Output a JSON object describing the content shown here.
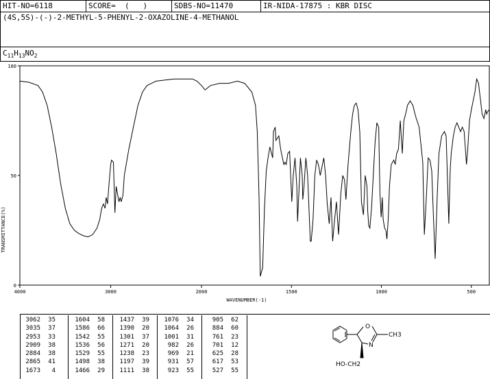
{
  "header": {
    "hit_no": "HIT-NO=6118",
    "score": "SCORE=  (   )",
    "sdbs_no": "SDBS-NO=11470",
    "ir_nida": "IR-NIDA-17875 : KBR DISC",
    "compound_name": "(4S,5S)-(-)-2-METHYL-5-PHENYL-2-OXAZOLINE-4-METHANOL",
    "formula_parts": [
      {
        "t": "C",
        "sub": false
      },
      {
        "t": "11",
        "sub": true
      },
      {
        "t": "H",
        "sub": false
      },
      {
        "t": "13",
        "sub": true
      },
      {
        "t": "NO",
        "sub": false
      },
      {
        "t": "2",
        "sub": true
      }
    ]
  },
  "chart_data": {
    "type": "line",
    "xlabel": "WAVENUMBER(-1)",
    "ylabel": "TRANSMITTANCE(%)",
    "xlim": [
      4000,
      400
    ],
    "ylim": [
      0,
      100
    ],
    "x_ticks": [
      4000,
      3000,
      2000,
      1500,
      1000,
      500
    ],
    "y_ticks": [
      0,
      50,
      100
    ],
    "series": [
      {
        "points": [
          [
            4000,
            93
          ],
          [
            3900,
            92.5
          ],
          [
            3800,
            91
          ],
          [
            3750,
            88
          ],
          [
            3700,
            82
          ],
          [
            3650,
            72
          ],
          [
            3600,
            60
          ],
          [
            3550,
            46
          ],
          [
            3500,
            35
          ],
          [
            3450,
            28
          ],
          [
            3400,
            25
          ],
          [
            3350,
            23.5
          ],
          [
            3300,
            22.5
          ],
          [
            3250,
            22
          ],
          [
            3200,
            23
          ],
          [
            3150,
            26
          ],
          [
            3120,
            30
          ],
          [
            3100,
            35
          ],
          [
            3080,
            37
          ],
          [
            3062,
            35
          ],
          [
            3050,
            40
          ],
          [
            3035,
            37
          ],
          [
            3020,
            45
          ],
          [
            3000,
            55
          ],
          [
            2990,
            57
          ],
          [
            2970,
            56
          ],
          [
            2953,
            33
          ],
          [
            2940,
            45
          ],
          [
            2909,
            38
          ],
          [
            2895,
            40
          ],
          [
            2884,
            38
          ],
          [
            2865,
            41
          ],
          [
            2850,
            50
          ],
          [
            2800,
            62
          ],
          [
            2750,
            72
          ],
          [
            2700,
            82
          ],
          [
            2650,
            88
          ],
          [
            2600,
            91
          ],
          [
            2550,
            92
          ],
          [
            2500,
            93
          ],
          [
            2400,
            93.5
          ],
          [
            2300,
            94
          ],
          [
            2200,
            94
          ],
          [
            2100,
            94
          ],
          [
            2050,
            93
          ],
          [
            2000,
            91
          ],
          [
            1980,
            89
          ],
          [
            1950,
            91
          ],
          [
            1900,
            92
          ],
          [
            1850,
            92
          ],
          [
            1800,
            93
          ],
          [
            1760,
            92
          ],
          [
            1740,
            90
          ],
          [
            1720,
            88
          ],
          [
            1700,
            82
          ],
          [
            1690,
            70
          ],
          [
            1680,
            40
          ],
          [
            1673,
            4
          ],
          [
            1660,
            8
          ],
          [
            1650,
            35
          ],
          [
            1640,
            52
          ],
          [
            1630,
            58
          ],
          [
            1620,
            63
          ],
          [
            1604,
            58
          ],
          [
            1600,
            70
          ],
          [
            1590,
            72
          ],
          [
            1586,
            66
          ],
          [
            1570,
            68
          ],
          [
            1560,
            62
          ],
          [
            1550,
            58
          ],
          [
            1542,
            55
          ],
          [
            1536,
            56
          ],
          [
            1529,
            55
          ],
          [
            1520,
            60
          ],
          [
            1510,
            61
          ],
          [
            1498,
            38
          ],
          [
            1490,
            50
          ],
          [
            1480,
            58
          ],
          [
            1470,
            45
          ],
          [
            1466,
            29
          ],
          [
            1460,
            40
          ],
          [
            1450,
            58
          ],
          [
            1440,
            50
          ],
          [
            1437,
            39
          ],
          [
            1430,
            45
          ],
          [
            1420,
            58
          ],
          [
            1410,
            50
          ],
          [
            1400,
            30
          ],
          [
            1395,
            20
          ],
          [
            1390,
            20
          ],
          [
            1380,
            30
          ],
          [
            1370,
            50
          ],
          [
            1360,
            57
          ],
          [
            1350,
            55
          ],
          [
            1340,
            50
          ],
          [
            1320,
            58
          ],
          [
            1310,
            50
          ],
          [
            1301,
            37
          ],
          [
            1290,
            28
          ],
          [
            1280,
            40
          ],
          [
            1271,
            20
          ],
          [
            1260,
            30
          ],
          [
            1250,
            38
          ],
          [
            1238,
            23
          ],
          [
            1225,
            42
          ],
          [
            1215,
            50
          ],
          [
            1205,
            48
          ],
          [
            1197,
            39
          ],
          [
            1185,
            55
          ],
          [
            1170,
            70
          ],
          [
            1160,
            78
          ],
          [
            1150,
            82
          ],
          [
            1140,
            83
          ],
          [
            1130,
            80
          ],
          [
            1120,
            70
          ],
          [
            1111,
            38
          ],
          [
            1100,
            32
          ],
          [
            1090,
            50
          ],
          [
            1080,
            45
          ],
          [
            1076,
            34
          ],
          [
            1070,
            27
          ],
          [
            1064,
            26
          ],
          [
            1055,
            35
          ],
          [
            1045,
            50
          ],
          [
            1035,
            65
          ],
          [
            1025,
            74
          ],
          [
            1015,
            72
          ],
          [
            1008,
            42
          ],
          [
            1001,
            31
          ],
          [
            995,
            40
          ],
          [
            990,
            30
          ],
          [
            982,
            26
          ],
          [
            975,
            25
          ],
          [
            969,
            21
          ],
          [
            962,
            30
          ],
          [
            955,
            45
          ],
          [
            945,
            55
          ],
          [
            931,
            57
          ],
          [
            923,
            55
          ],
          [
            915,
            60
          ],
          [
            905,
            62
          ],
          [
            895,
            75
          ],
          [
            884,
            60
          ],
          [
            875,
            75
          ],
          [
            865,
            78
          ],
          [
            855,
            82
          ],
          [
            840,
            84
          ],
          [
            825,
            82
          ],
          [
            810,
            77
          ],
          [
            790,
            72
          ],
          [
            770,
            56
          ],
          [
            761,
            23
          ],
          [
            750,
            40
          ],
          [
            740,
            58
          ],
          [
            730,
            57
          ],
          [
            720,
            52
          ],
          [
            710,
            30
          ],
          [
            701,
            12
          ],
          [
            690,
            40
          ],
          [
            680,
            60
          ],
          [
            665,
            68
          ],
          [
            650,
            70
          ],
          [
            640,
            68
          ],
          [
            635,
            55
          ],
          [
            625,
            28
          ],
          [
            617,
            53
          ],
          [
            612,
            60
          ],
          [
            600,
            68
          ],
          [
            590,
            72
          ],
          [
            580,
            74
          ],
          [
            570,
            72
          ],
          [
            560,
            70
          ],
          [
            550,
            72
          ],
          [
            540,
            70
          ],
          [
            527,
            55
          ],
          [
            520,
            62
          ],
          [
            510,
            75
          ],
          [
            500,
            80
          ],
          [
            490,
            84
          ],
          [
            480,
            88
          ],
          [
            470,
            94
          ],
          [
            460,
            92
          ],
          [
            450,
            85
          ],
          [
            440,
            78
          ],
          [
            430,
            76
          ],
          [
            420,
            80
          ],
          [
            415,
            78
          ],
          [
            410,
            79
          ],
          [
            400,
            80
          ]
        ]
      }
    ]
  },
  "peaks": [
    [
      [
        "3062",
        "35"
      ],
      [
        "3035",
        "37"
      ],
      [
        "2953",
        "33"
      ],
      [
        "2909",
        "38"
      ],
      [
        "2884",
        "38"
      ],
      [
        "2865",
        "41"
      ],
      [
        "1673",
        "4"
      ]
    ],
    [
      [
        "1604",
        "58"
      ],
      [
        "1586",
        "66"
      ],
      [
        "1542",
        "55"
      ],
      [
        "1536",
        "56"
      ],
      [
        "1529",
        "55"
      ],
      [
        "1498",
        "38"
      ],
      [
        "1466",
        "29"
      ]
    ],
    [
      [
        "1437",
        "39"
      ],
      [
        "1390",
        "20"
      ],
      [
        "1301",
        "37"
      ],
      [
        "1271",
        "20"
      ],
      [
        "1238",
        "23"
      ],
      [
        "1197",
        "39"
      ],
      [
        "1111",
        "38"
      ]
    ],
    [
      [
        "1076",
        "34"
      ],
      [
        "1064",
        "26"
      ],
      [
        "1001",
        "31"
      ],
      [
        "982",
        "26"
      ],
      [
        "969",
        "21"
      ],
      [
        "931",
        "57"
      ],
      [
        "923",
        "55"
      ]
    ],
    [
      [
        "905",
        "62"
      ],
      [
        "884",
        "60"
      ],
      [
        "761",
        "23"
      ],
      [
        "701",
        "12"
      ],
      [
        "625",
        "28"
      ],
      [
        "617",
        "53"
      ],
      [
        "527",
        "55"
      ]
    ]
  ],
  "structure": {
    "substituent_methyl": "CH3",
    "hetero_o": "O",
    "hetero_n": "N",
    "substituent_hydroxymethyl": "HO-CH2"
  }
}
